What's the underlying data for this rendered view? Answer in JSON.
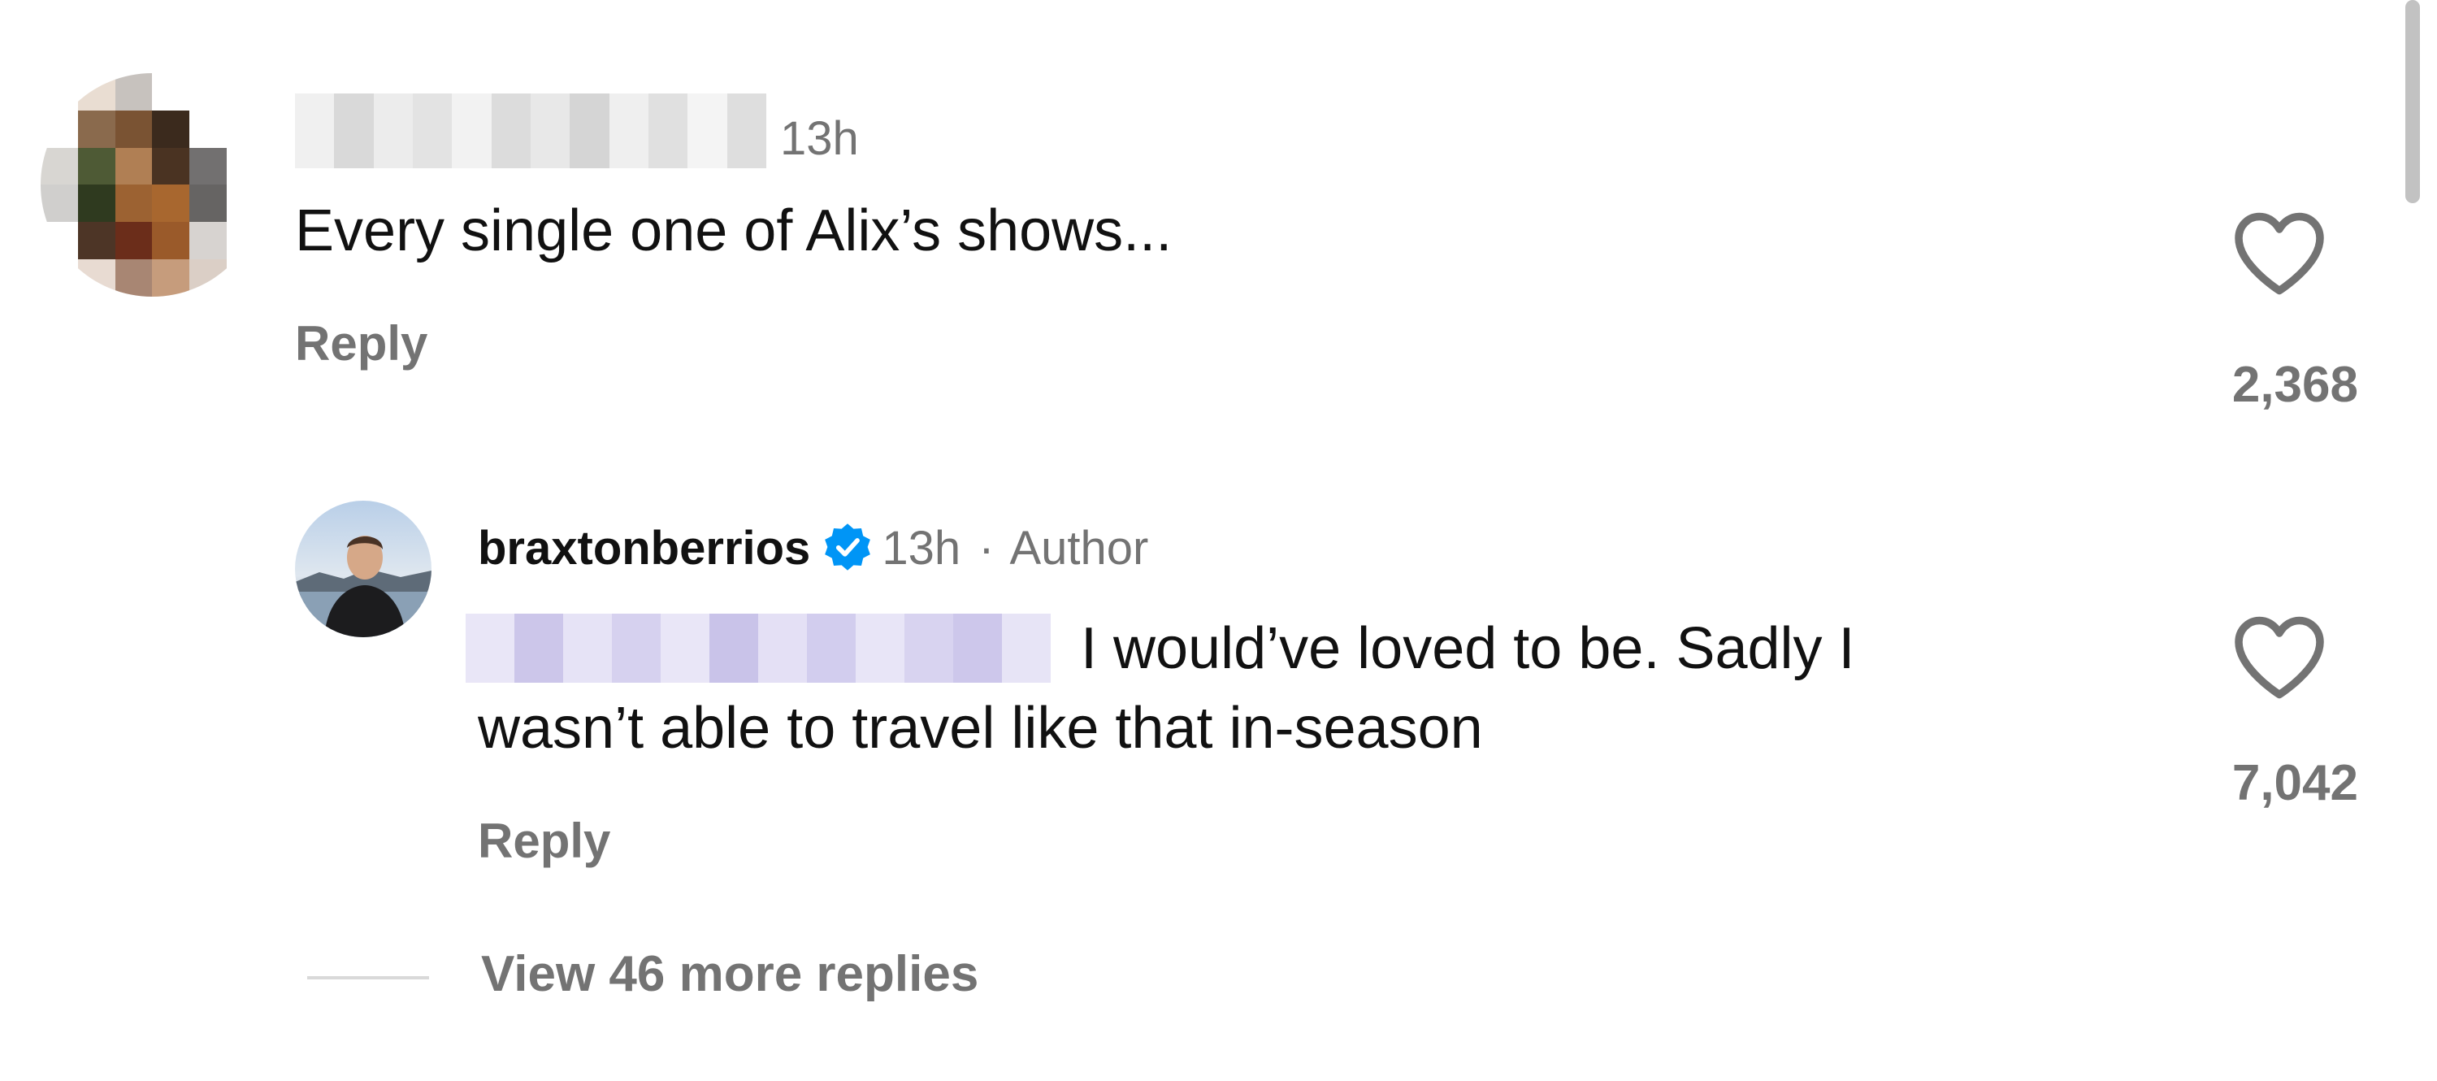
{
  "comment": {
    "username": "",
    "timestamp": "13h",
    "text": "Every single one of Alix’s shows...",
    "reply_label": "Reply",
    "likes": "2,368",
    "like_icon": "heart-outline-icon"
  },
  "reply": {
    "username": "braxtonberrios",
    "verified": true,
    "timestamp": "13h",
    "separator": "·",
    "role_badge": "Author",
    "mention": "",
    "text_line1": "I would’ve loved to be. Sadly I",
    "text_line2": "wasn’t able to travel like that in-season",
    "reply_label": "Reply",
    "likes": "7,042",
    "like_icon": "heart-outline-icon"
  },
  "view_more": {
    "label": "View 46 more replies"
  },
  "colors": {
    "text": "#111111",
    "muted": "#737373",
    "verified_blue": "#0095f6",
    "background": "#ffffff"
  }
}
